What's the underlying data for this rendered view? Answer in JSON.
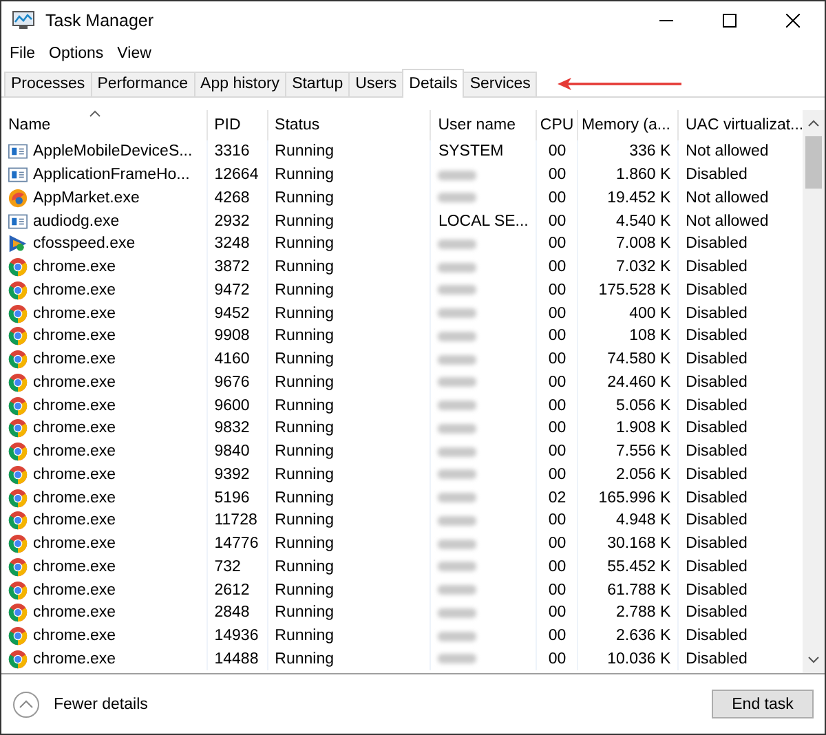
{
  "window": {
    "title": "Task Manager"
  },
  "menu": [
    {
      "label": "File"
    },
    {
      "label": "Options"
    },
    {
      "label": "View"
    }
  ],
  "tabs": [
    {
      "label": "Processes",
      "selected": false
    },
    {
      "label": "Performance",
      "selected": false
    },
    {
      "label": "App history",
      "selected": false
    },
    {
      "label": "Startup",
      "selected": false
    },
    {
      "label": "Users",
      "selected": false
    },
    {
      "label": "Details",
      "selected": true
    },
    {
      "label": "Services",
      "selected": false
    }
  ],
  "annotation": {
    "kind": "arrow"
  },
  "table": {
    "columns": [
      {
        "label": "Name",
        "sorted": true
      },
      {
        "label": "PID"
      },
      {
        "label": "Status"
      },
      {
        "label": "User name"
      },
      {
        "label": "CPU"
      },
      {
        "label": "Memory (a..."
      },
      {
        "label": "UAC virtualizat..."
      }
    ],
    "rows": [
      {
        "kind": "service",
        "name": "AppleMobileDeviceS...",
        "pid": "3316",
        "status": "Running",
        "user": "SYSTEM",
        "cpu": "00",
        "memory": "336 K",
        "uac": "Not allowed"
      },
      {
        "kind": "service",
        "name": "ApplicationFrameHo...",
        "pid": "12664",
        "status": "Running",
        "user_blurred": true,
        "cpu": "00",
        "memory": "1.860 K",
        "uac": "Disabled"
      },
      {
        "kind": "appmarket",
        "name": "AppMarket.exe",
        "pid": "4268",
        "status": "Running",
        "user_blurred": true,
        "cpu": "00",
        "memory": "19.452 K",
        "uac": "Not allowed"
      },
      {
        "kind": "service",
        "name": "audiodg.exe",
        "pid": "2932",
        "status": "Running",
        "user": "LOCAL SE...",
        "cpu": "00",
        "memory": "4.540 K",
        "uac": "Not allowed"
      },
      {
        "kind": "cfos",
        "name": "cfosspeed.exe",
        "pid": "3248",
        "status": "Running",
        "user_blurred": true,
        "cpu": "00",
        "memory": "7.008 K",
        "uac": "Disabled"
      },
      {
        "kind": "chrome",
        "name": "chrome.exe",
        "pid": "3872",
        "status": "Running",
        "user_blurred": true,
        "cpu": "00",
        "memory": "7.032 K",
        "uac": "Disabled"
      },
      {
        "kind": "chrome",
        "name": "chrome.exe",
        "pid": "9472",
        "status": "Running",
        "user_blurred": true,
        "cpu": "00",
        "memory": "175.528 K",
        "uac": "Disabled"
      },
      {
        "kind": "chrome",
        "name": "chrome.exe",
        "pid": "9452",
        "status": "Running",
        "user_blurred": true,
        "cpu": "00",
        "memory": "400 K",
        "uac": "Disabled"
      },
      {
        "kind": "chrome",
        "name": "chrome.exe",
        "pid": "9908",
        "status": "Running",
        "user_blurred": true,
        "cpu": "00",
        "memory": "108 K",
        "uac": "Disabled"
      },
      {
        "kind": "chrome",
        "name": "chrome.exe",
        "pid": "4160",
        "status": "Running",
        "user_blurred": true,
        "cpu": "00",
        "memory": "74.580 K",
        "uac": "Disabled"
      },
      {
        "kind": "chrome",
        "name": "chrome.exe",
        "pid": "9676",
        "status": "Running",
        "user_blurred": true,
        "cpu": "00",
        "memory": "24.460 K",
        "uac": "Disabled"
      },
      {
        "kind": "chrome",
        "name": "chrome.exe",
        "pid": "9600",
        "status": "Running",
        "user_blurred": true,
        "cpu": "00",
        "memory": "5.056 K",
        "uac": "Disabled"
      },
      {
        "kind": "chrome",
        "name": "chrome.exe",
        "pid": "9832",
        "status": "Running",
        "user_blurred": true,
        "cpu": "00",
        "memory": "1.908 K",
        "uac": "Disabled"
      },
      {
        "kind": "chrome",
        "name": "chrome.exe",
        "pid": "9840",
        "status": "Running",
        "user_blurred": true,
        "cpu": "00",
        "memory": "7.556 K",
        "uac": "Disabled"
      },
      {
        "kind": "chrome",
        "name": "chrome.exe",
        "pid": "9392",
        "status": "Running",
        "user_blurred": true,
        "cpu": "00",
        "memory": "2.056 K",
        "uac": "Disabled"
      },
      {
        "kind": "chrome",
        "name": "chrome.exe",
        "pid": "5196",
        "status": "Running",
        "user_blurred": true,
        "cpu": "02",
        "memory": "165.996 K",
        "uac": "Disabled"
      },
      {
        "kind": "chrome",
        "name": "chrome.exe",
        "pid": "11728",
        "status": "Running",
        "user_blurred": true,
        "cpu": "00",
        "memory": "4.948 K",
        "uac": "Disabled"
      },
      {
        "kind": "chrome",
        "name": "chrome.exe",
        "pid": "14776",
        "status": "Running",
        "user_blurred": true,
        "cpu": "00",
        "memory": "30.168 K",
        "uac": "Disabled"
      },
      {
        "kind": "chrome",
        "name": "chrome.exe",
        "pid": "732",
        "status": "Running",
        "user_blurred": true,
        "cpu": "00",
        "memory": "55.452 K",
        "uac": "Disabled"
      },
      {
        "kind": "chrome",
        "name": "chrome.exe",
        "pid": "2612",
        "status": "Running",
        "user_blurred": true,
        "cpu": "00",
        "memory": "61.788 K",
        "uac": "Disabled"
      },
      {
        "kind": "chrome",
        "name": "chrome.exe",
        "pid": "2848",
        "status": "Running",
        "user_blurred": true,
        "cpu": "00",
        "memory": "2.788 K",
        "uac": "Disabled"
      },
      {
        "kind": "chrome",
        "name": "chrome.exe",
        "pid": "14936",
        "status": "Running",
        "user_blurred": true,
        "cpu": "00",
        "memory": "2.636 K",
        "uac": "Disabled"
      },
      {
        "kind": "chrome",
        "name": "chrome.exe",
        "pid": "14488",
        "status": "Running",
        "user_blurred": true,
        "cpu": "00",
        "memory": "10.036 K",
        "uac": "Disabled"
      }
    ]
  },
  "footer": {
    "toggle": {
      "label": "Fewer details"
    },
    "button": {
      "label": "End task"
    }
  }
}
